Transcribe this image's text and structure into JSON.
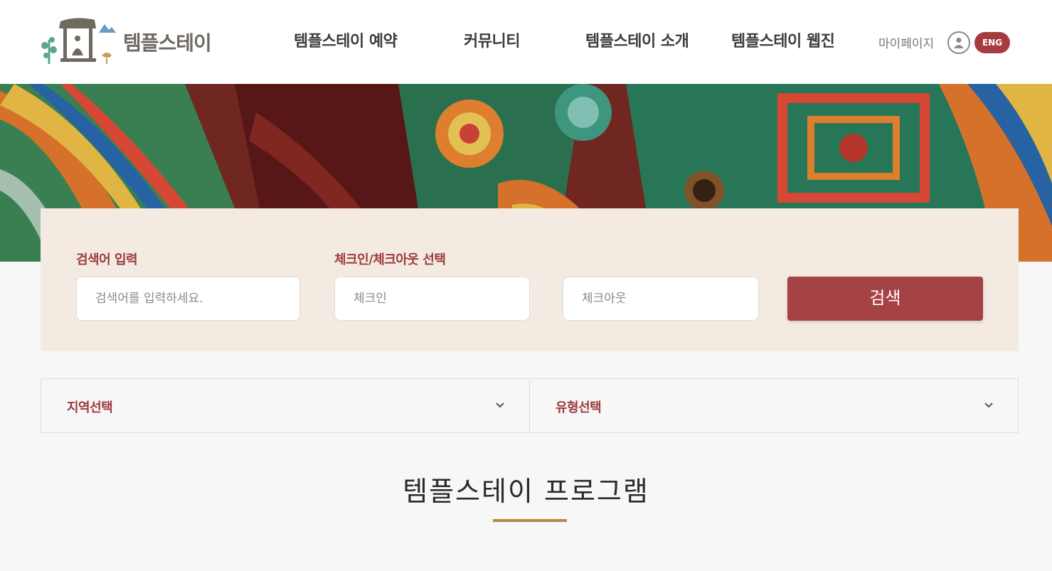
{
  "header": {
    "logo_text": "템플스테이",
    "nav": [
      {
        "label": "템플스테이 예약"
      },
      {
        "label": "커뮤니티"
      },
      {
        "label": "템플스테이 소개"
      },
      {
        "label": "템플스테이 웹진"
      }
    ],
    "mypage_label": "마이페이지",
    "user_icon": "user-icon",
    "lang_button": "ENG"
  },
  "search": {
    "keyword_label": "검색어 입력",
    "keyword_placeholder": "검색어를 입력하세요.",
    "date_label": "체크인/체크아웃 선택",
    "checkin_placeholder": "체크인",
    "checkout_placeholder": "체크아웃",
    "search_button": "검색"
  },
  "filters": [
    {
      "label": "지역선택",
      "icon": "chevron-down-icon"
    },
    {
      "label": "유형선택",
      "icon": "chevron-down-icon"
    }
  ],
  "section": {
    "title": "템플스테이 프로그램"
  },
  "colors": {
    "accent": "#a54245",
    "label": "#9c3a3c",
    "panel_bg": "#f3eae2",
    "title_bar": "#b58943"
  }
}
